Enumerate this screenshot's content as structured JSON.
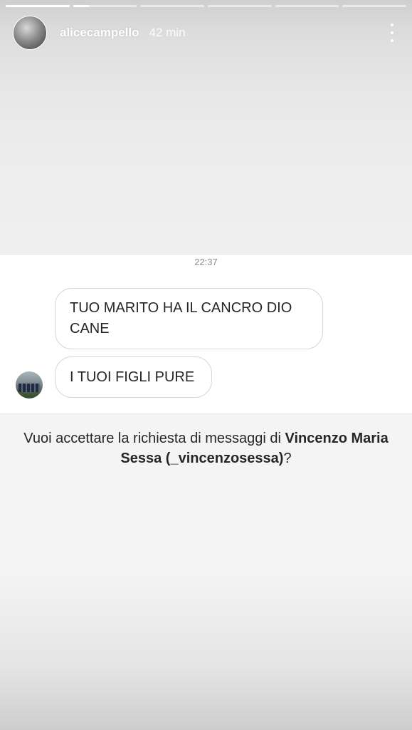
{
  "story": {
    "progress_segments": [
      1.0,
      0.25,
      0,
      0,
      0,
      0
    ],
    "username": "alicecampello",
    "posted_ago": "42 min",
    "menu_icon": "more-vertical-icon"
  },
  "conversation": {
    "timestamp": "22:37",
    "messages": [
      {
        "text": "TUO MARITO HA IL CANCRO DIO CANE"
      },
      {
        "text": "I TUOI FIGLI PURE"
      }
    ]
  },
  "request": {
    "prefix": "Vuoi accettare la richiesta di messaggi di ",
    "name": "Vincenzo Maria Sessa (_vincenzosessa)",
    "suffix": "?"
  },
  "colors": {
    "text": "#262626",
    "muted": "#8e8e8e",
    "bubble_border": "#d6d6d6"
  }
}
